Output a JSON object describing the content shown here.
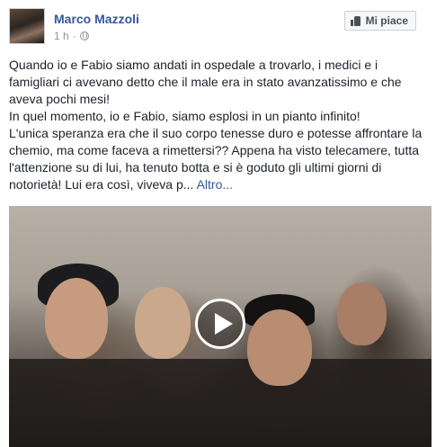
{
  "post": {
    "author": "Marco Mazzoli",
    "time": "1 h",
    "separator": "·",
    "like_button": "Mi piace",
    "paragraphs": [
      "Quando io e Fabio siamo andati in ospedale a trovarlo, i medici e i famigliari ci avevano detto che il male era in stato avanzatissimo e che aveva pochi mesi!",
      "In quel momento, io e Fabio, siamo esplosi in un pianto infinito!",
      "L'unica speranza era che il suo corpo tenesse duro e potesse affrontare la chemio, ma come faceva a rimettersi?? Appena ha visto telecamere, tutta l'attenzione su di lui, ha tenuto botta e si è goduto gli ultimi giorni di notorietà! Lui era così, viveva p..."
    ],
    "more_link": "Altro..."
  },
  "icons": {
    "privacy": "globe-icon",
    "like": "thumbs-up-icon",
    "play": "play-icon"
  },
  "colors": {
    "link": "#365899",
    "text": "#1d2129",
    "meta": "#90949c"
  }
}
